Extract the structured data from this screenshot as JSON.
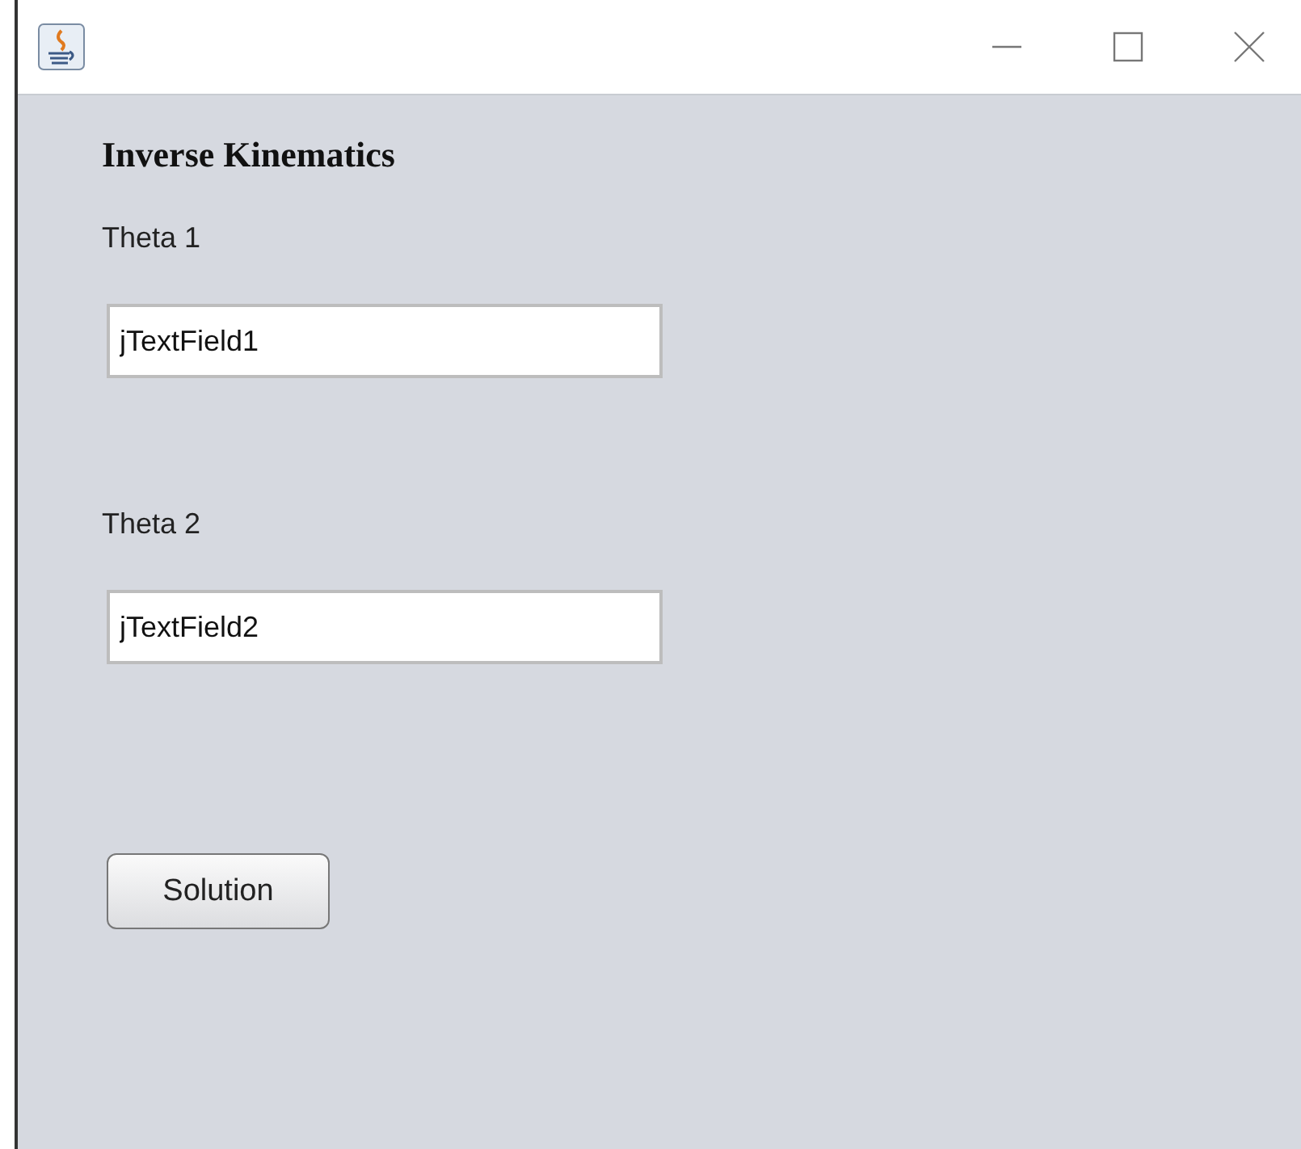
{
  "title": "Inverse Kinematics",
  "fields": [
    {
      "label": "Theta 1",
      "value": "jTextField1"
    },
    {
      "label": "Theta 2",
      "value": "jTextField2"
    }
  ],
  "button": "Solution"
}
